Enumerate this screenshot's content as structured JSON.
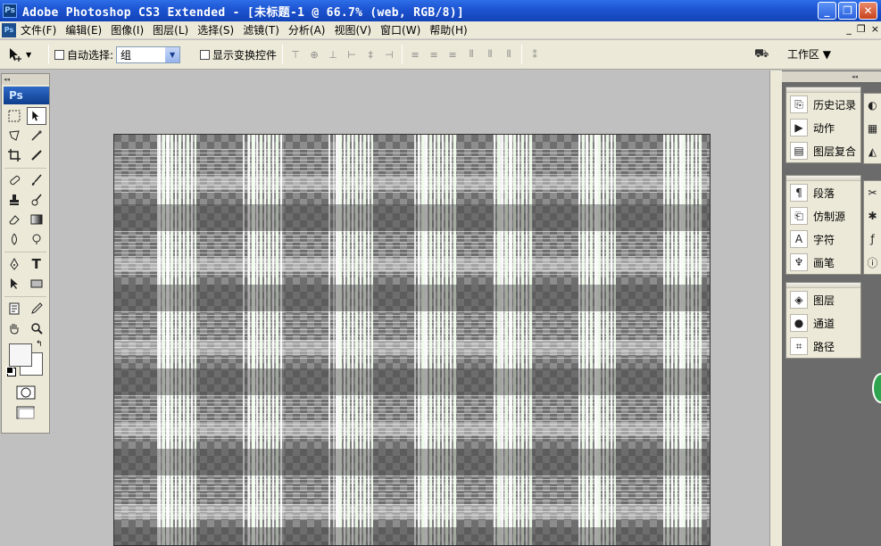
{
  "window": {
    "app_icon": "Ps",
    "title": "Adobe Photoshop CS3 Extended - [未标题-1 @ 66.7% (web, RGB/8)]",
    "minimize": "_",
    "maximize": "❐",
    "close": "✕"
  },
  "menu": {
    "icon": "Ps",
    "items": [
      "文件(F)",
      "编辑(E)",
      "图像(I)",
      "图层(L)",
      "选择(S)",
      "滤镜(T)",
      "分析(A)",
      "视图(V)",
      "窗口(W)",
      "帮助(H)"
    ],
    "mdi_minimize": "_",
    "mdi_restore": "❐",
    "mdi_close": "×"
  },
  "options": {
    "auto_select_label": "自动选择:",
    "auto_select_value": "组",
    "show_transform_label": "显示变换控件",
    "workspace_label": "工作区 ▼"
  },
  "toolbox": {
    "logo": "Ps",
    "collapse": "◂◂",
    "type_tool": "T"
  },
  "right_dock": {
    "collapse": "◂◂",
    "group1": [
      "历史记录",
      "动作",
      "图层复合"
    ],
    "group2": [
      "段落",
      "仿制源",
      "字符",
      "画笔"
    ],
    "group3": [
      "图层",
      "通道",
      "路径"
    ]
  },
  "colors": {
    "titlebar": "#1d53d0",
    "chrome": "#ece9d8",
    "workspace_bg": "#c0c0c0",
    "dock_bg": "#6b6b6b"
  },
  "icons": {
    "move_tool": "move-tool-icon",
    "marquee": "rect-marquee-icon",
    "lasso": "lasso-icon",
    "magic_wand": "magic-wand-icon",
    "crop": "crop-icon",
    "eyedropper": "eyedropper-icon"
  }
}
